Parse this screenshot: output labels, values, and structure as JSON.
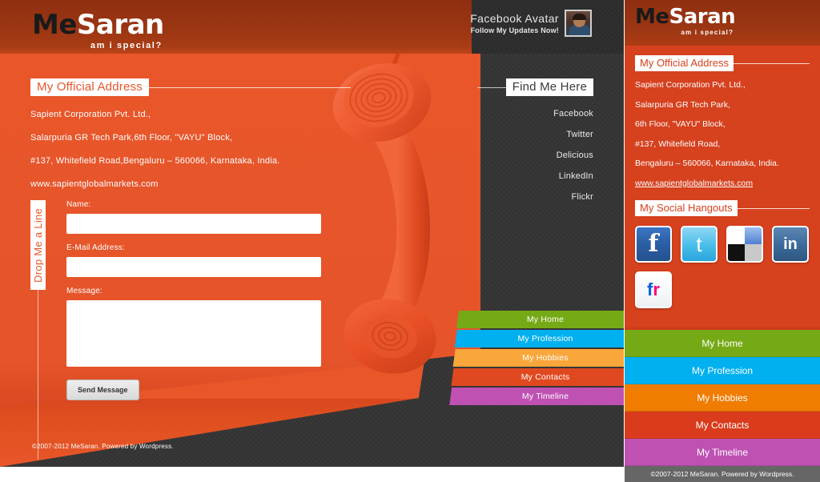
{
  "brand": {
    "name_part1": "Me",
    "name_part2": "Saran",
    "tagline": "am i special?"
  },
  "colors": {
    "orange": "#e8562a",
    "header_dark_orange": "#9b3613",
    "panel_dark": "#333333",
    "mobile_bg": "#d6411e",
    "nav_home": "#76a916",
    "nav_profession": "#00b0ef",
    "nav_hobbies": "#f9a63a",
    "nav_contacts": "#e0491f",
    "nav_timeline": "#bf51b3",
    "mobile_nav_hobbies": "#f07c00",
    "footer_gray": "#666666"
  },
  "header": {
    "facebook_avatar_title": "Facebook Avatar",
    "facebook_avatar_subtitle": "Follow My Updates Now!",
    "avatar_icon": "user-photo-avatar"
  },
  "official_address": {
    "heading": "My Official Address",
    "lines": [
      "Sapient Corporation Pvt. Ltd.,",
      "Salarpuria GR Tech Park,6th Floor, \"VAYU\" Block,",
      "#137, Whitefield Road,Bengaluru – 560066, Karnataka, India.",
      "www.sapientglobalmarkets.com"
    ]
  },
  "find_me_here": {
    "heading": "Find Me Here",
    "links": [
      {
        "label": "Facebook"
      },
      {
        "label": "Twitter"
      },
      {
        "label": "Delicious"
      },
      {
        "label": "LinkedIn"
      },
      {
        "label": "Flickr"
      }
    ]
  },
  "contact_form": {
    "tab_label": "Drop Me a Line",
    "name_label": "Name:",
    "name_value": "",
    "name_placeholder": "",
    "email_label": "E-Mail Address:",
    "email_value": "",
    "email_placeholder": "",
    "message_label": "Message:",
    "message_value": "",
    "message_placeholder": "",
    "submit_label": "Send Message"
  },
  "nav": {
    "items": [
      {
        "label": "My Home",
        "color": "#76a916"
      },
      {
        "label": "My Profession",
        "color": "#00b0ef"
      },
      {
        "label": "My Hobbies",
        "color": "#f9a63a"
      },
      {
        "label": "My Contacts",
        "color": "#e0491f"
      },
      {
        "label": "My Timeline",
        "color": "#bf51b3"
      }
    ]
  },
  "footer": {
    "text": "©2007-2012 MeSaran. Powered by Wordpress."
  },
  "mobile": {
    "official_address": {
      "heading": "My Official Address",
      "lines": [
        "Sapient Corporation Pvt. Ltd.,",
        "Salarpuria GR Tech Park,",
        "6th Floor, \"VAYU\" Block,",
        "#137, Whitefield Road,",
        "Bengaluru – 560066, Karnataka, India."
      ],
      "website": "www.sapientglobalmarkets.com"
    },
    "social": {
      "heading": "My Social Hangouts",
      "icons": [
        {
          "name": "facebook-icon",
          "label": "f"
        },
        {
          "name": "twitter-icon",
          "label": "t"
        },
        {
          "name": "delicious-icon",
          "label": ""
        },
        {
          "name": "linkedin-icon",
          "label": "in"
        },
        {
          "name": "flickr-icon",
          "label_f": "f",
          "label_r": "r"
        }
      ]
    },
    "nav": {
      "items": [
        {
          "label": "My Home",
          "color": "#76a916"
        },
        {
          "label": "My Profession",
          "color": "#00b0ef"
        },
        {
          "label": "My Hobbies",
          "color": "#f07c00"
        },
        {
          "label": "My Contacts",
          "color": "#d93b1c"
        },
        {
          "label": "My Timeline",
          "color": "#bf51b3"
        }
      ]
    },
    "footer": {
      "text": "©2007-2012 MeSaran. Powered by Wordpress."
    }
  }
}
